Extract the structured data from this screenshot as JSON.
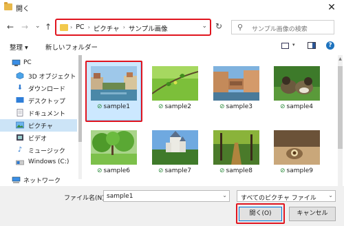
{
  "window": {
    "title": "開く",
    "close": "✕"
  },
  "nav": {
    "back": "←",
    "forward": "→",
    "recent": "⌄",
    "up": "↑",
    "breadcrumbs": [
      "PC",
      "ピクチャ",
      "サンプル画像"
    ],
    "crumb_sep": "›",
    "refresh": "↻",
    "search_placeholder": "サンプル画像の検索"
  },
  "toolbar": {
    "organize": "整理 ▾",
    "new_folder": "新しいフォルダー"
  },
  "sidebar": {
    "items": [
      {
        "label": "PC",
        "icon": "pc-icon"
      },
      {
        "label": "3D オブジェクト",
        "icon": "3d-objects-icon"
      },
      {
        "label": "ダウンロード",
        "icon": "download-icon"
      },
      {
        "label": "デスクトップ",
        "icon": "desktop-icon"
      },
      {
        "label": "ドキュメント",
        "icon": "document-icon"
      },
      {
        "label": "ピクチャ",
        "icon": "pictures-icon"
      },
      {
        "label": "ビデオ",
        "icon": "video-icon"
      },
      {
        "label": "ミュージック",
        "icon": "music-icon"
      },
      {
        "label": "Windows (C:)",
        "icon": "drive-icon"
      },
      {
        "label": "ネットワーク",
        "icon": "network-icon"
      }
    ]
  },
  "files": [
    {
      "name": "sample1",
      "selected": true
    },
    {
      "name": "sample2",
      "selected": false
    },
    {
      "name": "sample3",
      "selected": false
    },
    {
      "name": "sample4",
      "selected": false
    },
    {
      "name": "sample6",
      "selected": false
    },
    {
      "name": "sample7",
      "selected": false
    },
    {
      "name": "sample8",
      "selected": false
    },
    {
      "name": "sample9",
      "selected": false
    }
  ],
  "footer": {
    "filename_label": "ファイル名(N):",
    "filename_value": "sample1",
    "filetype_value": "すべてのピクチャ ファイル",
    "open_button": "開く(O)",
    "cancel_button": "キャンセル"
  },
  "colors": {
    "highlight": "#e0141e",
    "selection": "#cce8ff",
    "accent": "#0078d7"
  }
}
